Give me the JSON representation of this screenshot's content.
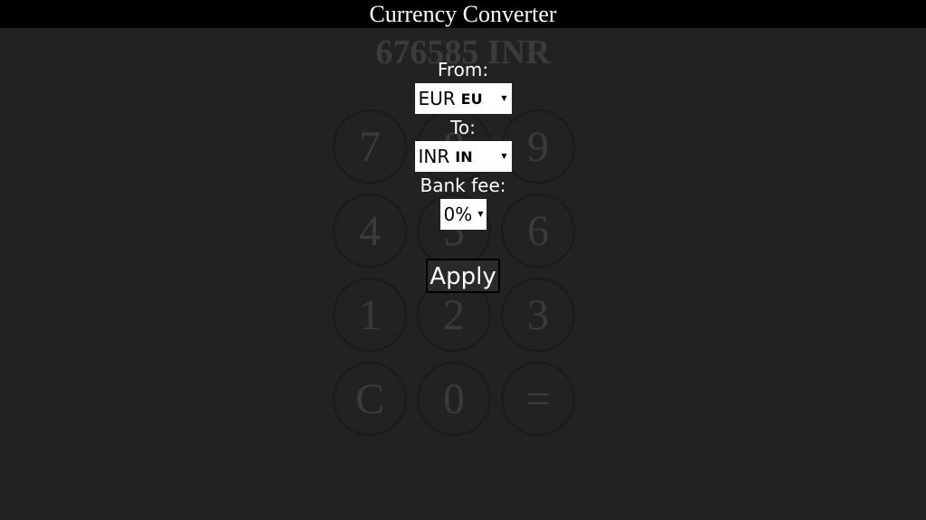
{
  "header": {
    "title": "Currency Converter"
  },
  "display": {
    "value": "676585 INR"
  },
  "keypad": [
    "7",
    "8",
    "9",
    "4",
    "5",
    "6",
    "1",
    "2",
    "3",
    "C",
    "0",
    "="
  ],
  "form": {
    "from_label": "From:",
    "from_value": "EUR",
    "from_code": "EU",
    "to_label": "To:",
    "to_value": "INR",
    "to_code": "IN",
    "fee_label": "Bank fee:",
    "fee_value": "0%",
    "apply_label": "Apply"
  }
}
